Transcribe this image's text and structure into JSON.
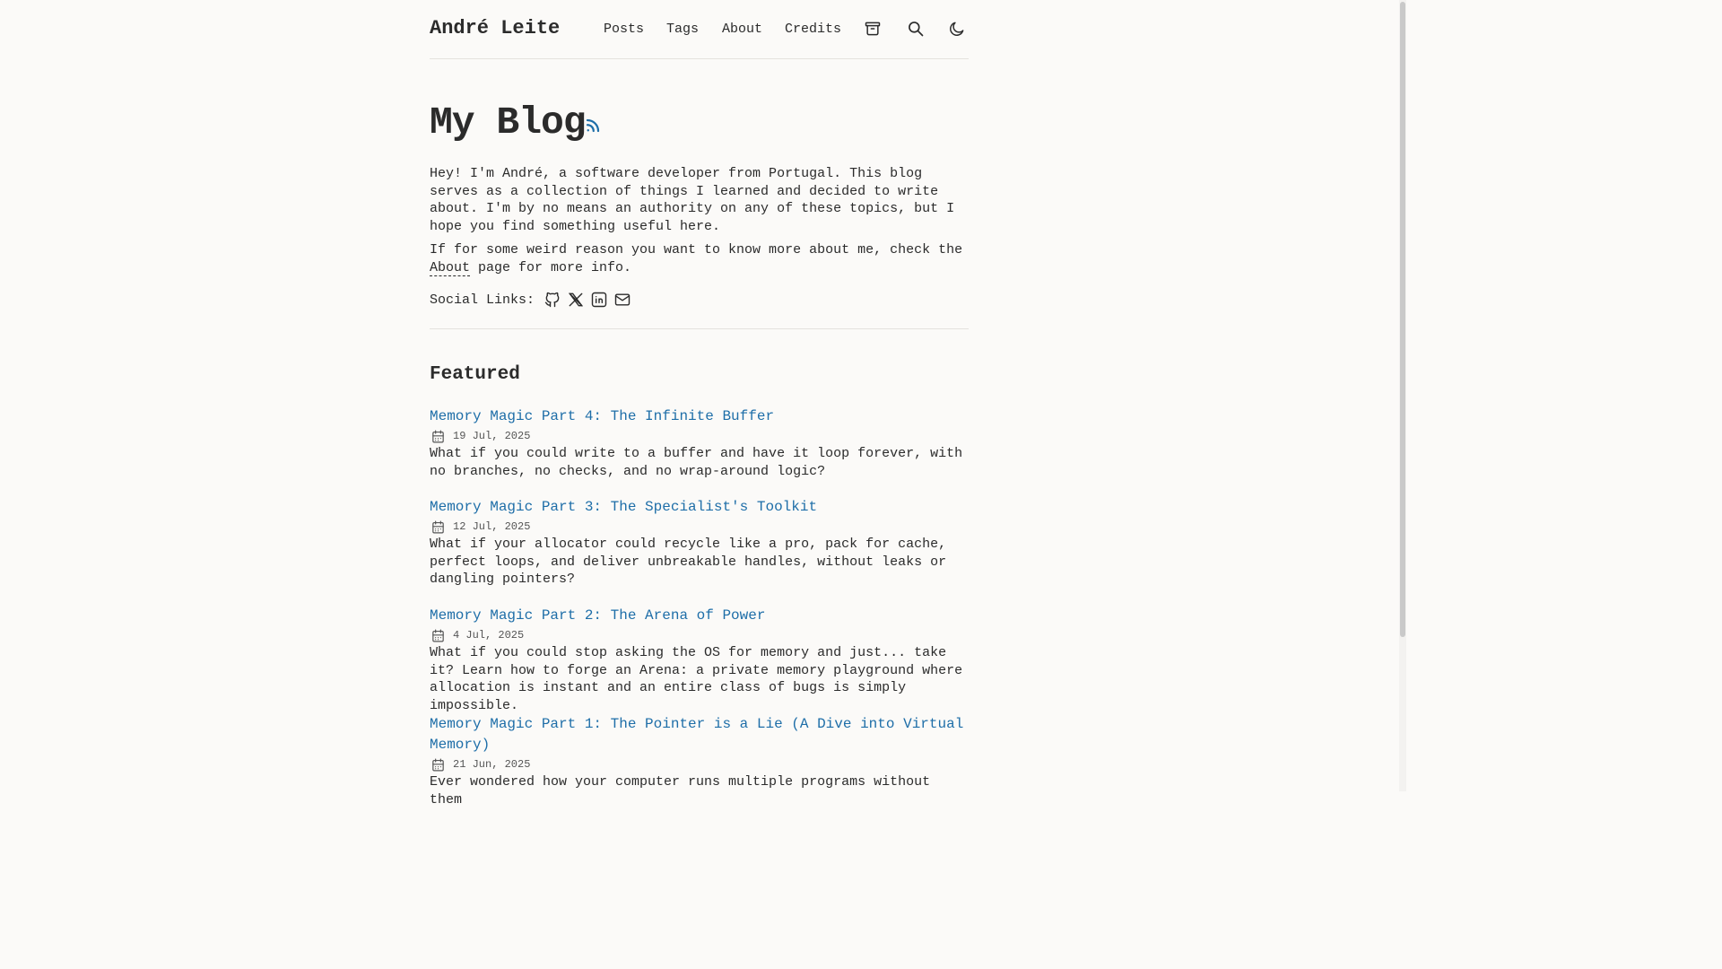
{
  "header": {
    "site_title": "André Leite",
    "nav": [
      "Posts",
      "Tags",
      "About",
      "Credits"
    ]
  },
  "icons": {
    "archive": "archive-icon",
    "search": "search-icon",
    "theme": "moon-icon",
    "rss": "rss-icon",
    "github": "github-icon",
    "x": "x-icon",
    "linkedin": "linkedin-icon",
    "mail": "mail-icon",
    "calendar": "calendar-icon"
  },
  "main": {
    "title": "My Blog",
    "intro_p1": "Hey! I'm André, a software developer from Portugal. This blog serves as a collection of things I learned and decided to write about. I'm by no means an authority on any of these topics, but I hope you find something useful here.",
    "intro_p2_before": "If for some weird reason you want to know more about me, check the ",
    "intro_p2_link": "About",
    "intro_p2_after": " page for more info.",
    "social_label": "Social Links:"
  },
  "featured": {
    "heading": "Featured",
    "posts": [
      {
        "title": "Memory Magic Part 4: The Infinite Buffer",
        "date": "19 Jul, 2025",
        "description": "What if you could write to a buffer and have it loop forever, with no branches, no checks, and no wrap-around logic?"
      },
      {
        "title": "Memory Magic Part 3: The Specialist's Toolkit",
        "date": "12 Jul, 2025",
        "description": "What if your allocator could recycle like a pro, pack for cache, perfect loops, and deliver unbreakable handles, without leaks or dangling pointers?"
      },
      {
        "title": "Memory Magic Part 2: The Arena of Power",
        "date": "4 Jul, 2025",
        "description": "What if you could stop asking the OS for memory and just... take it? Learn how to forge an Arena: a private memory playground where allocation is instant and an entire class of bugs is simply impossible."
      },
      {
        "title": "Memory Magic Part 1: The Pointer is a Lie (A Dive into Virtual Memory)",
        "date": "21 Jun, 2025",
        "description": "Ever wondered how your computer runs multiple programs without them"
      }
    ]
  },
  "colors": {
    "background": "#fbfaf8",
    "text": "#2b2b2b",
    "accent": "#1e6ea8"
  }
}
